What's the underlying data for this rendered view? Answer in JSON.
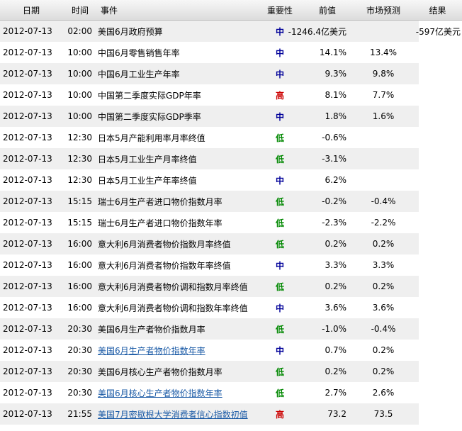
{
  "headers": {
    "date": "日期",
    "time": "时间",
    "event": "事件",
    "importance": "重要性",
    "previous": "前值",
    "forecast": "市场预测",
    "actual": "结果"
  },
  "importance_colors": {
    "高": "#cc0000",
    "中": "#000099",
    "低": "#008800"
  },
  "link_color": "#1a5aa6",
  "rows": [
    {
      "date": "2012-07-13",
      "time": "02:00",
      "event": "美国6月政府预算",
      "link": false,
      "importance": "中",
      "previous": "-1246.4亿美元",
      "forecast": "",
      "actual": "-597亿美元"
    },
    {
      "date": "2012-07-13",
      "time": "10:00",
      "event": "中国6月零售销售年率",
      "link": false,
      "importance": "中",
      "previous": "14.1%",
      "forecast": "13.4%",
      "actual": ""
    },
    {
      "date": "2012-07-13",
      "time": "10:00",
      "event": "中国6月工业生产年率",
      "link": false,
      "importance": "中",
      "previous": "9.3%",
      "forecast": "9.8%",
      "actual": ""
    },
    {
      "date": "2012-07-13",
      "time": "10:00",
      "event": "中国第二季度实际GDP年率",
      "link": false,
      "importance": "高",
      "previous": "8.1%",
      "forecast": "7.7%",
      "actual": ""
    },
    {
      "date": "2012-07-13",
      "time": "10:00",
      "event": "中国第二季度实际GDP季率",
      "link": false,
      "importance": "中",
      "previous": "1.8%",
      "forecast": "1.6%",
      "actual": ""
    },
    {
      "date": "2012-07-13",
      "time": "12:30",
      "event": "日本5月产能利用率月率终值",
      "link": false,
      "importance": "低",
      "previous": "-0.6%",
      "forecast": "",
      "actual": ""
    },
    {
      "date": "2012-07-13",
      "time": "12:30",
      "event": "日本5月工业生产月率终值",
      "link": false,
      "importance": "低",
      "previous": "-3.1%",
      "forecast": "",
      "actual": ""
    },
    {
      "date": "2012-07-13",
      "time": "12:30",
      "event": "日本5月工业生产年率终值",
      "link": false,
      "importance": "中",
      "previous": "6.2%",
      "forecast": "",
      "actual": ""
    },
    {
      "date": "2012-07-13",
      "time": "15:15",
      "event": "瑞士6月生产者进口物价指数月率",
      "link": false,
      "importance": "低",
      "previous": "-0.2%",
      "forecast": "-0.4%",
      "actual": ""
    },
    {
      "date": "2012-07-13",
      "time": "15:15",
      "event": "瑞士6月生产者进口物价指数年率",
      "link": false,
      "importance": "低",
      "previous": "-2.3%",
      "forecast": "-2.2%",
      "actual": ""
    },
    {
      "date": "2012-07-13",
      "time": "16:00",
      "event": "意大利6月消费者物价指数月率终值",
      "link": false,
      "importance": "低",
      "previous": "0.2%",
      "forecast": "0.2%",
      "actual": ""
    },
    {
      "date": "2012-07-13",
      "time": "16:00",
      "event": "意大利6月消费者物价指数年率终值",
      "link": false,
      "importance": "中",
      "previous": "3.3%",
      "forecast": "3.3%",
      "actual": ""
    },
    {
      "date": "2012-07-13",
      "time": "16:00",
      "event": "意大利6月消费者物价调和指数月率终值",
      "link": false,
      "importance": "低",
      "previous": "0.2%",
      "forecast": "0.2%",
      "actual": ""
    },
    {
      "date": "2012-07-13",
      "time": "16:00",
      "event": "意大利6月消费者物价调和指数年率终值",
      "link": false,
      "importance": "中",
      "previous": "3.6%",
      "forecast": "3.6%",
      "actual": ""
    },
    {
      "date": "2012-07-13",
      "time": "20:30",
      "event": "美国6月生产者物价指数月率",
      "link": false,
      "importance": "低",
      "previous": "-1.0%",
      "forecast": "-0.4%",
      "actual": ""
    },
    {
      "date": "2012-07-13",
      "time": "20:30",
      "event": "美国6月生产者物价指数年率",
      "link": true,
      "importance": "中",
      "previous": "0.7%",
      "forecast": "0.2%",
      "actual": ""
    },
    {
      "date": "2012-07-13",
      "time": "20:30",
      "event": "美国6月核心生产者物价指数月率",
      "link": false,
      "importance": "低",
      "previous": "0.2%",
      "forecast": "0.2%",
      "actual": ""
    },
    {
      "date": "2012-07-13",
      "time": "20:30",
      "event": "美国6月核心生产者物价指数年率",
      "link": true,
      "importance": "低",
      "previous": "2.7%",
      "forecast": "2.6%",
      "actual": ""
    },
    {
      "date": "2012-07-13",
      "time": "21:55",
      "event": "美国7月密歇根大学消费者信心指数初值",
      "link": true,
      "importance": "高",
      "previous": "73.2",
      "forecast": "73.5",
      "actual": ""
    }
  ]
}
